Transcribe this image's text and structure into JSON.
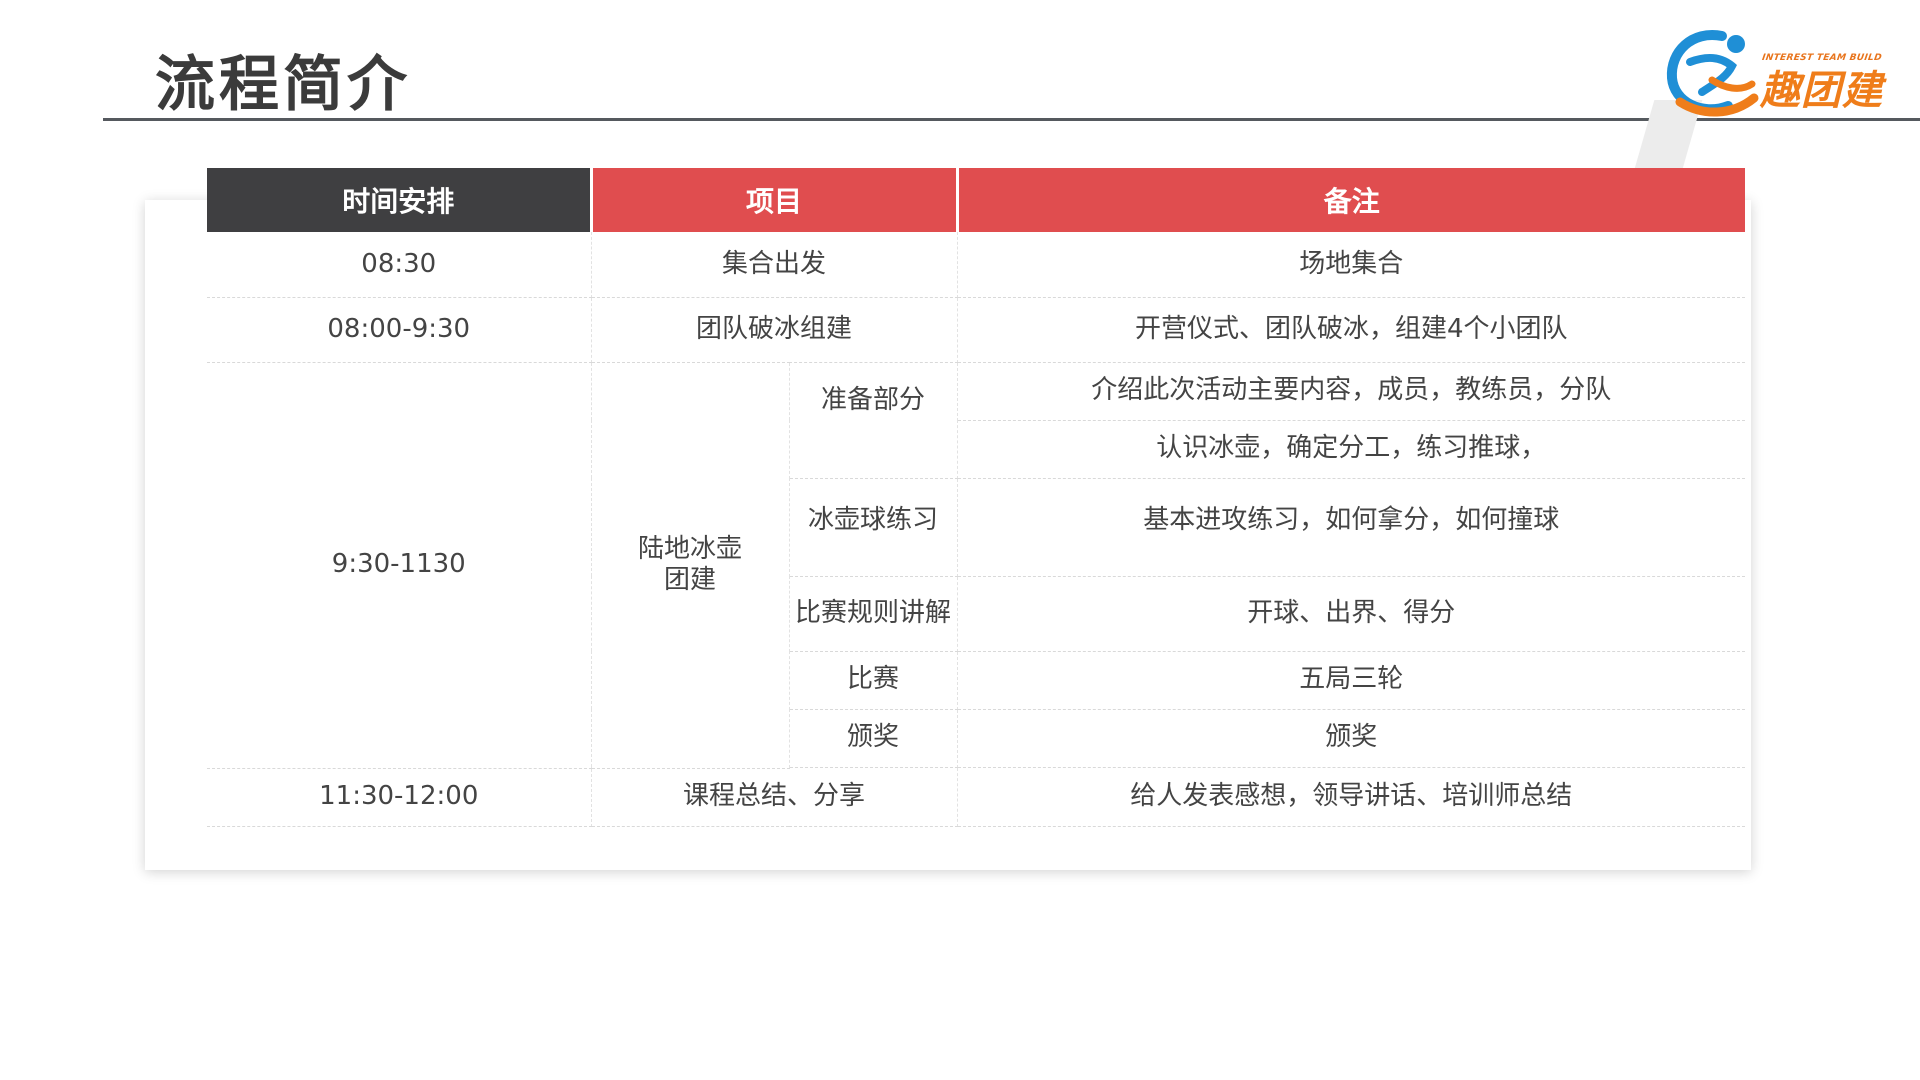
{
  "slide": {
    "title": "流程简介"
  },
  "logo": {
    "tagline": "INTEREST TEAM BUILD",
    "name": "趣团建",
    "colors": {
      "blue": "#1f8fd6",
      "orange": "#ef7d1a"
    }
  },
  "colors": {
    "header_dark": "#3f3f41",
    "header_red": "#e04d4f",
    "title_rule": "#55595e"
  },
  "table": {
    "headers": {
      "time": "时间安排",
      "project": "项目",
      "note": "备注"
    },
    "rows": {
      "r1": {
        "time": "08:30",
        "project": "集合出发",
        "note": "场地集合"
      },
      "r2": {
        "time": "08:00-9:30",
        "project": "团队破冰组建",
        "note": "开营仪式、团队破冰，组建4个小团队"
      },
      "r3": {
        "time": "9:30-1130",
        "project_line1": "陆地冰壶",
        "project_line2": "团建",
        "items": {
          "prep": "准备部分",
          "prep_note1": "介绍此次活动主要内容，成员，教练员，分队",
          "prep_note2": "认识冰壶，确定分工，练习推球，",
          "practice": "冰壶球练习",
          "practice_note": "基本进攻练习，如何拿分，如何撞球",
          "rules": "比赛规则讲解",
          "rules_note": "开球、出界、得分",
          "match": "比赛",
          "match_note": "五局三轮",
          "award": "颁奖",
          "award_note": "颁奖"
        }
      },
      "r4": {
        "time": "11:30-12:00",
        "project": "课程总结、分享",
        "note": "给人发表感想，领导讲话、培训师总结"
      }
    }
  }
}
